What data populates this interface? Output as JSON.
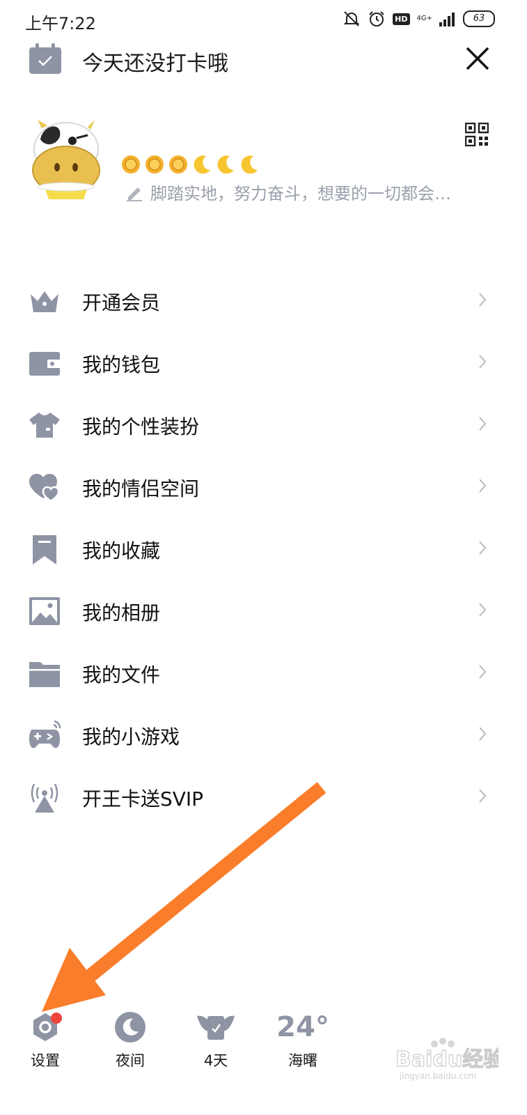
{
  "status_bar": {
    "time": "上午7:22",
    "network": "4G+",
    "hd": "HD",
    "battery": "63"
  },
  "checkin": {
    "text": "今天还没打卡哦"
  },
  "profile": {
    "signature": "脚踏实地，努力奋斗，想要的一切都会…",
    "level_icons": [
      "sun",
      "sun",
      "sun",
      "moon",
      "moon",
      "moon"
    ]
  },
  "menu": {
    "items": [
      {
        "label": "开通会员",
        "icon": "crown-icon"
      },
      {
        "label": "我的钱包",
        "icon": "wallet-icon"
      },
      {
        "label": "我的个性装扮",
        "icon": "shirt-icon"
      },
      {
        "label": "我的情侣空间",
        "icon": "hearts-icon"
      },
      {
        "label": "我的收藏",
        "icon": "bookmark-icon"
      },
      {
        "label": "我的相册",
        "icon": "photo-icon"
      },
      {
        "label": "我的文件",
        "icon": "folder-icon"
      },
      {
        "label": "我的小游戏",
        "icon": "gamepad-icon"
      },
      {
        "label": "开王卡送SVIP",
        "icon": "signal-tower-icon"
      }
    ]
  },
  "bottom_bar": {
    "settings": "设置",
    "night": "夜间",
    "streak": "4天",
    "temperature": "24°",
    "city": "海曙"
  },
  "watermark": {
    "text": "Baidu经验",
    "url_text": "jingyan.baidu.com"
  },
  "colors": {
    "icon_gray": "#8e94a4",
    "arrow_orange": "#f97d2a",
    "badge_red": "#f0453a",
    "subtitle_gray": "#9aa0ab"
  }
}
